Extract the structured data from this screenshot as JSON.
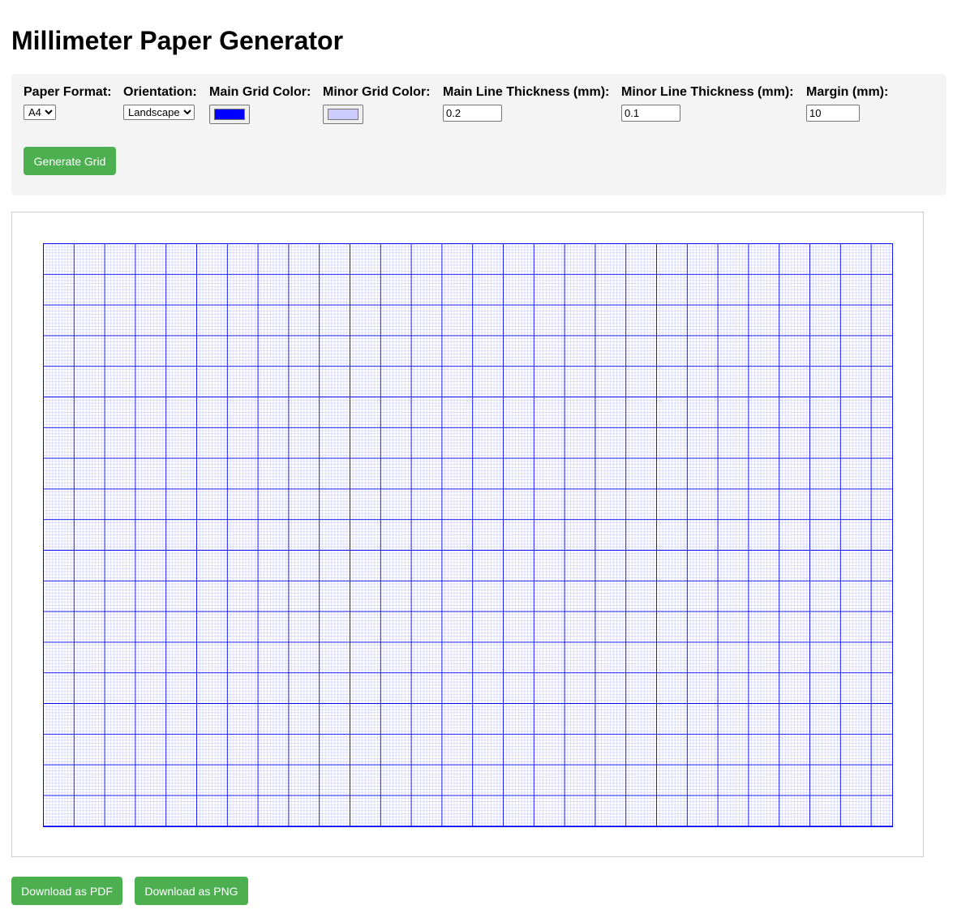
{
  "page": {
    "title": "Millimeter Paper Generator"
  },
  "controls": {
    "paper_format": {
      "label": "Paper Format:",
      "value": "A4",
      "options": [
        "A4"
      ]
    },
    "orientation": {
      "label": "Orientation:",
      "value": "Landscape",
      "options": [
        "Landscape"
      ]
    },
    "main_grid_color": {
      "label": "Main Grid Color:",
      "value": "#0000ff"
    },
    "minor_grid_color": {
      "label": "Minor Grid Color:",
      "value": "#ccccff"
    },
    "main_line_thickness": {
      "label": "Main Line Thickness (mm):",
      "value": "0.2"
    },
    "minor_line_thickness": {
      "label": "Minor Line Thickness (mm):",
      "value": "0.1"
    },
    "margin": {
      "label": "Margin (mm):",
      "value": "10"
    },
    "generate_label": "Generate Grid"
  },
  "downloads": {
    "pdf_label": "Download as PDF",
    "png_label": "Download as PNG"
  },
  "colors": {
    "accent": "#4caf50",
    "panel_bg": "#f4f4f4",
    "main_grid": "#0000ff",
    "minor_grid": "#ccccff"
  }
}
